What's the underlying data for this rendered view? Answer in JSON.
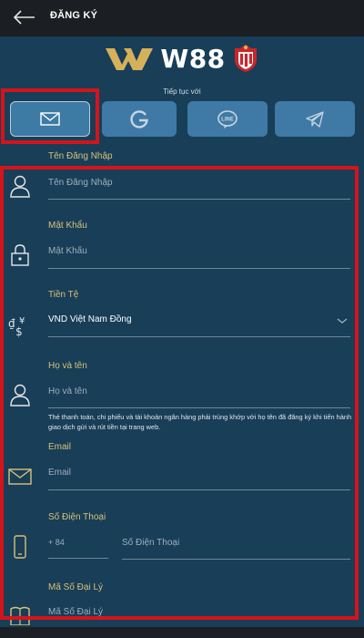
{
  "header": {
    "title": "ĐĂNG KÝ",
    "back_icon": "arrow-left-icon"
  },
  "logo": {
    "text": "W88",
    "mark": "WW"
  },
  "social": {
    "continue_label": "Tiếp tục với",
    "buttons": [
      {
        "name": "email",
        "icon": "envelope-icon"
      },
      {
        "name": "google",
        "icon": "google-icon"
      },
      {
        "name": "line",
        "icon": "line-chat-icon",
        "badge": "LINE"
      },
      {
        "name": "telegram",
        "icon": "telegram-icon"
      }
    ]
  },
  "form": {
    "username": {
      "label": "Tên Đăng Nhập",
      "placeholder": "Tên Đăng Nhập",
      "icon": "user-icon"
    },
    "password": {
      "label": "Mật Khẩu",
      "placeholder": "Mật Khẩu",
      "icon": "lock-icon"
    },
    "currency": {
      "label": "Tiền Tệ",
      "value": "VND Việt Nam Đồng",
      "icon": "currency-icon"
    },
    "fullname": {
      "label": "Họ và tên",
      "placeholder": "Họ và tên",
      "icon": "user-icon",
      "hint": "Thẻ thanh toán, chi phiếu và tài khoản ngân hàng phải trùng khớp với họ tên đã đăng ký khi tiến hành giao dịch gửi và rút tiền tại trang web."
    },
    "email": {
      "label": "Email",
      "placeholder": "Email",
      "icon": "envelope-icon"
    },
    "phone": {
      "label": "Số Điện Thoại",
      "prefix": "+ 84",
      "placeholder": "Số Điện Thoại",
      "icon": "phone-icon"
    },
    "agent": {
      "label": "Mã Số Đại Lý",
      "placeholder": "Mã Số Đại Lý",
      "icon": "book-icon"
    }
  },
  "colors": {
    "background": "#183e58",
    "topbar": "#1b1f23",
    "button": "#3f7aa6",
    "label_gold": "#d9c178",
    "highlight_red": "#d4141b"
  }
}
